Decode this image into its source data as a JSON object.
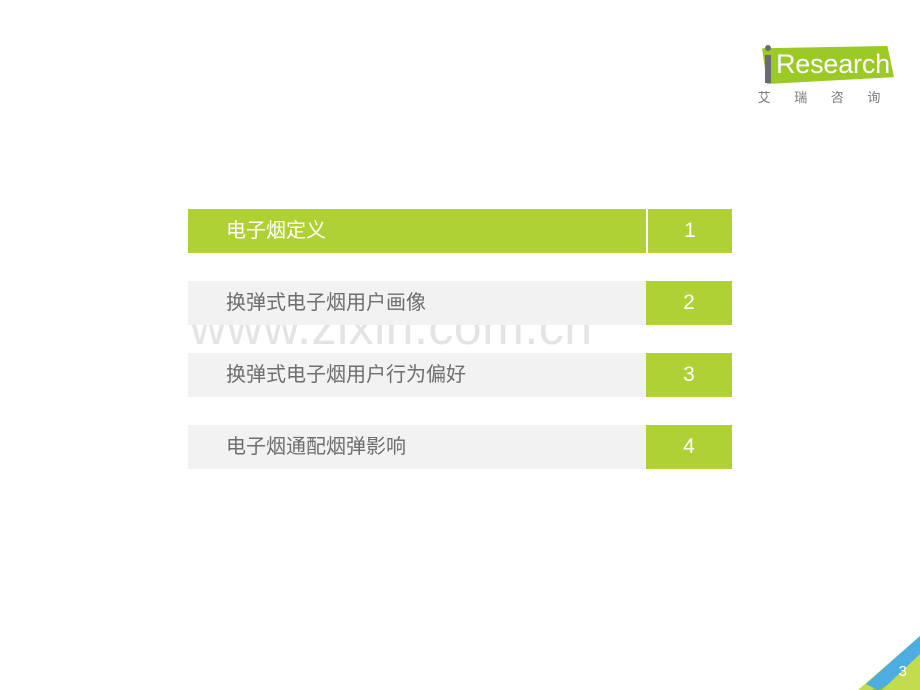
{
  "brand": {
    "logo_word": "Research",
    "logo_initial": "i",
    "logo_subtitle": "艾 瑞 咨 询",
    "green": "#AFD136",
    "logo_green": "#9BC926",
    "gray_row": "#F2F2F2",
    "text_gray": "#6E6E6E"
  },
  "watermark": {
    "text": "www.zixin.com.cn"
  },
  "toc": {
    "items": [
      {
        "label": "电子烟定义",
        "number": "1",
        "active": true
      },
      {
        "label": "换弹式电子烟用户画像",
        "number": "2",
        "active": false
      },
      {
        "label": "换弹式电子烟用户行为偏好",
        "number": "3",
        "active": false
      },
      {
        "label": "电子烟通配烟弹影响",
        "number": "4",
        "active": false
      }
    ]
  },
  "footer": {
    "page_number": "3",
    "corner_blue": "#4DACE0",
    "corner_green_light": "#C3DC4E",
    "corner_green_dark": "#8CBE3F"
  }
}
